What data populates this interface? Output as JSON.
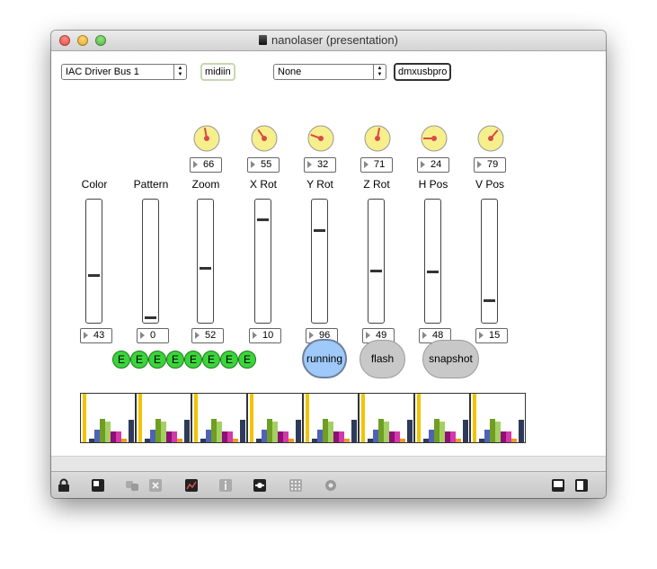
{
  "window": {
    "title": "nanolaser (presentation)"
  },
  "midi_input": {
    "device": "IAC Driver Bus 1",
    "object_label": "midiin"
  },
  "dmx_output": {
    "device": "None",
    "object_label": "dmxusbpro"
  },
  "dials": [
    {
      "value": "66",
      "angle": -10
    },
    {
      "value": "55",
      "angle": -35
    },
    {
      "value": "32",
      "angle": -70
    },
    {
      "value": "71",
      "angle": 10
    },
    {
      "value": "24",
      "angle": -90
    },
    {
      "value": "79",
      "angle": 40
    }
  ],
  "params": [
    {
      "label": "Color",
      "value": "43",
      "level": 0.37
    },
    {
      "label": "Pattern",
      "value": "0",
      "level": 0.0
    },
    {
      "label": "Zoom",
      "value": "52",
      "level": 0.43
    },
    {
      "label": "X Rot",
      "value": "10",
      "level": 0.85
    },
    {
      "label": "Y Rot",
      "value": "96",
      "level": 0.76
    },
    {
      "label": "Z Rot",
      "value": "49",
      "level": 0.41
    },
    {
      "label": "H Pos",
      "value": "48",
      "level": 0.4
    },
    {
      "label": "V Pos",
      "value": "15",
      "level": 0.15
    }
  ],
  "e_buttons": [
    "E",
    "E",
    "E",
    "E",
    "E",
    "E",
    "E",
    "E"
  ],
  "buttons": {
    "running": "running",
    "flash": "flash",
    "snapshot": "snapshot"
  },
  "patterns": [
    {
      "bars": [
        {
          "color": "#f2c400",
          "h": 1.0
        },
        {
          "color": "#2d3a5a",
          "h": 0.08
        },
        {
          "color": "#4e63b5",
          "h": 0.25
        },
        {
          "color": "#6f9e22",
          "h": 0.48
        },
        {
          "color": "#a4cf63",
          "h": 0.42
        },
        {
          "color": "#8e0f75",
          "h": 0.22
        },
        {
          "color": "#d13aa8",
          "h": 0.22
        },
        {
          "color": "#f09a20",
          "h": 0.08
        },
        {
          "color": "#2d3a5a",
          "h": 0.47
        }
      ]
    },
    {
      "bars": [
        {
          "color": "#f2c400",
          "h": 1.0
        },
        {
          "color": "#2d3a5a",
          "h": 0.08
        },
        {
          "color": "#4e63b5",
          "h": 0.25
        },
        {
          "color": "#6f9e22",
          "h": 0.48
        },
        {
          "color": "#a4cf63",
          "h": 0.42
        },
        {
          "color": "#8e0f75",
          "h": 0.22
        },
        {
          "color": "#d13aa8",
          "h": 0.22
        },
        {
          "color": "#f09a20",
          "h": 0.08
        },
        {
          "color": "#2d3a5a",
          "h": 0.47
        }
      ]
    },
    {
      "bars": [
        {
          "color": "#f2c400",
          "h": 1.0
        },
        {
          "color": "#2d3a5a",
          "h": 0.08
        },
        {
          "color": "#4e63b5",
          "h": 0.25
        },
        {
          "color": "#6f9e22",
          "h": 0.48
        },
        {
          "color": "#a4cf63",
          "h": 0.42
        },
        {
          "color": "#8e0f75",
          "h": 0.22
        },
        {
          "color": "#d13aa8",
          "h": 0.22
        },
        {
          "color": "#f09a20",
          "h": 0.08
        },
        {
          "color": "#2d3a5a",
          "h": 0.47
        }
      ]
    },
    {
      "bars": [
        {
          "color": "#f2c400",
          "h": 1.0
        },
        {
          "color": "#2d3a5a",
          "h": 0.08
        },
        {
          "color": "#4e63b5",
          "h": 0.25
        },
        {
          "color": "#6f9e22",
          "h": 0.48
        },
        {
          "color": "#a4cf63",
          "h": 0.42
        },
        {
          "color": "#8e0f75",
          "h": 0.22
        },
        {
          "color": "#d13aa8",
          "h": 0.22
        },
        {
          "color": "#f09a20",
          "h": 0.08
        },
        {
          "color": "#2d3a5a",
          "h": 0.47
        }
      ]
    },
    {
      "bars": [
        {
          "color": "#f2c400",
          "h": 1.0
        },
        {
          "color": "#2d3a5a",
          "h": 0.08
        },
        {
          "color": "#4e63b5",
          "h": 0.25
        },
        {
          "color": "#6f9e22",
          "h": 0.48
        },
        {
          "color": "#a4cf63",
          "h": 0.42
        },
        {
          "color": "#8e0f75",
          "h": 0.22
        },
        {
          "color": "#d13aa8",
          "h": 0.22
        },
        {
          "color": "#f09a20",
          "h": 0.08
        },
        {
          "color": "#2d3a5a",
          "h": 0.47
        }
      ]
    },
    {
      "bars": [
        {
          "color": "#f2c400",
          "h": 1.0
        },
        {
          "color": "#2d3a5a",
          "h": 0.08
        },
        {
          "color": "#4e63b5",
          "h": 0.25
        },
        {
          "color": "#6f9e22",
          "h": 0.48
        },
        {
          "color": "#a4cf63",
          "h": 0.42
        },
        {
          "color": "#8e0f75",
          "h": 0.22
        },
        {
          "color": "#d13aa8",
          "h": 0.22
        },
        {
          "color": "#f09a20",
          "h": 0.08
        },
        {
          "color": "#2d3a5a",
          "h": 0.47
        }
      ]
    },
    {
      "bars": [
        {
          "color": "#f2c400",
          "h": 1.0
        },
        {
          "color": "#2d3a5a",
          "h": 0.08
        },
        {
          "color": "#4e63b5",
          "h": 0.25
        },
        {
          "color": "#6f9e22",
          "h": 0.48
        },
        {
          "color": "#a4cf63",
          "h": 0.42
        },
        {
          "color": "#8e0f75",
          "h": 0.22
        },
        {
          "color": "#d13aa8",
          "h": 0.22
        },
        {
          "color": "#f09a20",
          "h": 0.08
        },
        {
          "color": "#2d3a5a",
          "h": 0.47
        }
      ]
    },
    {
      "bars": [
        {
          "color": "#f2c400",
          "h": 1.0
        },
        {
          "color": "#2d3a5a",
          "h": 0.08
        },
        {
          "color": "#4e63b5",
          "h": 0.25
        },
        {
          "color": "#6f9e22",
          "h": 0.48
        },
        {
          "color": "#a4cf63",
          "h": 0.42
        },
        {
          "color": "#8e0f75",
          "h": 0.22
        },
        {
          "color": "#d13aa8",
          "h": 0.22
        },
        {
          "color": "#f09a20",
          "h": 0.08
        },
        {
          "color": "#2d3a5a",
          "h": 0.47
        }
      ]
    }
  ],
  "toolbar_icons": [
    "lock-icon",
    "presentation-icon",
    "patcher-icons-icon",
    "close-box-icon",
    "debug-icon",
    "info-icon",
    "connect-icon",
    "grid-icon",
    "gear-icon",
    "left-panel-icon",
    "right-panel-icon"
  ],
  "colors": {
    "dial_fill": "#f7ef8c",
    "dial_needle": "#d94a4a",
    "e_button": "#3bd43b",
    "running": "#9ec9f8"
  }
}
